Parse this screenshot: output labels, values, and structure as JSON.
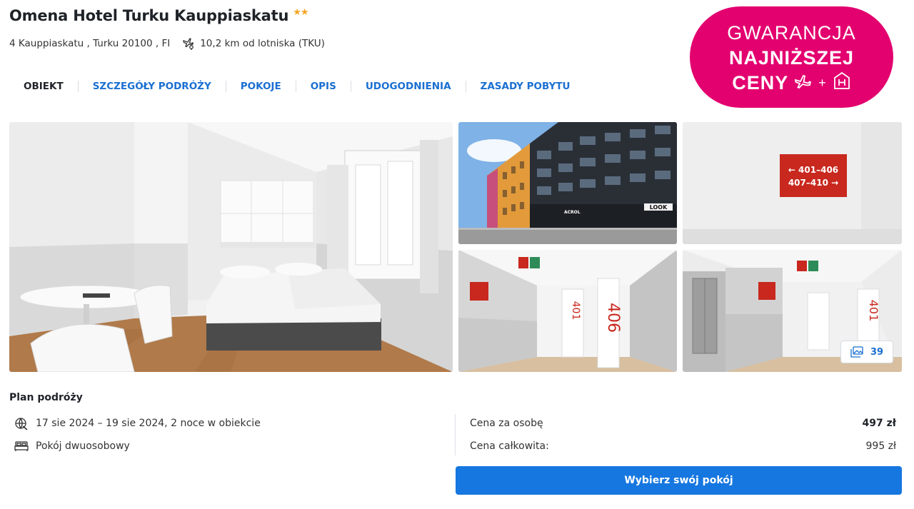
{
  "hotel": {
    "name": "Omena Hotel Turku Kauppiaskatu",
    "stars": "★★",
    "address": "4 Kauppiaskatu , Turku 20100 , FI",
    "airport_distance": "10,2 km od lotniska (TKU)"
  },
  "tabs": [
    {
      "label": "OBIEKT"
    },
    {
      "label": "SZCZEGÓŁY PODRÓŻY"
    },
    {
      "label": "POKOJE"
    },
    {
      "label": "OPIS"
    },
    {
      "label": "UDOGODNIENIA"
    },
    {
      "label": "ZASADY POBYTU"
    }
  ],
  "badge": {
    "line1": "GWARANCJA",
    "line2": "NAJNIŻSZEJ",
    "line3": "CENY",
    "plus": "+",
    "color": "#e3006f"
  },
  "gallery": {
    "count": "39",
    "signs": {
      "sign1": "← 401–406",
      "sign2": "407–410 →",
      "door_a": "401",
      "door_b": "406",
      "door_c": "401",
      "wall_a": "LOOK",
      "wall_b": "ACROL"
    }
  },
  "plan": {
    "title": "Plan podróży",
    "dates": "17 sie 2024 – 19 sie 2024, 2 noce w obiekcie",
    "room": "Pokój dwuosobowy"
  },
  "pricing": {
    "per_person_label": "Cena za osobę",
    "per_person_value": "497 zł",
    "total_label": "Cena całkowita:",
    "total_value": "995 zł"
  },
  "cta": {
    "label": "Wybierz swój pokój",
    "color": "#1677e0"
  }
}
